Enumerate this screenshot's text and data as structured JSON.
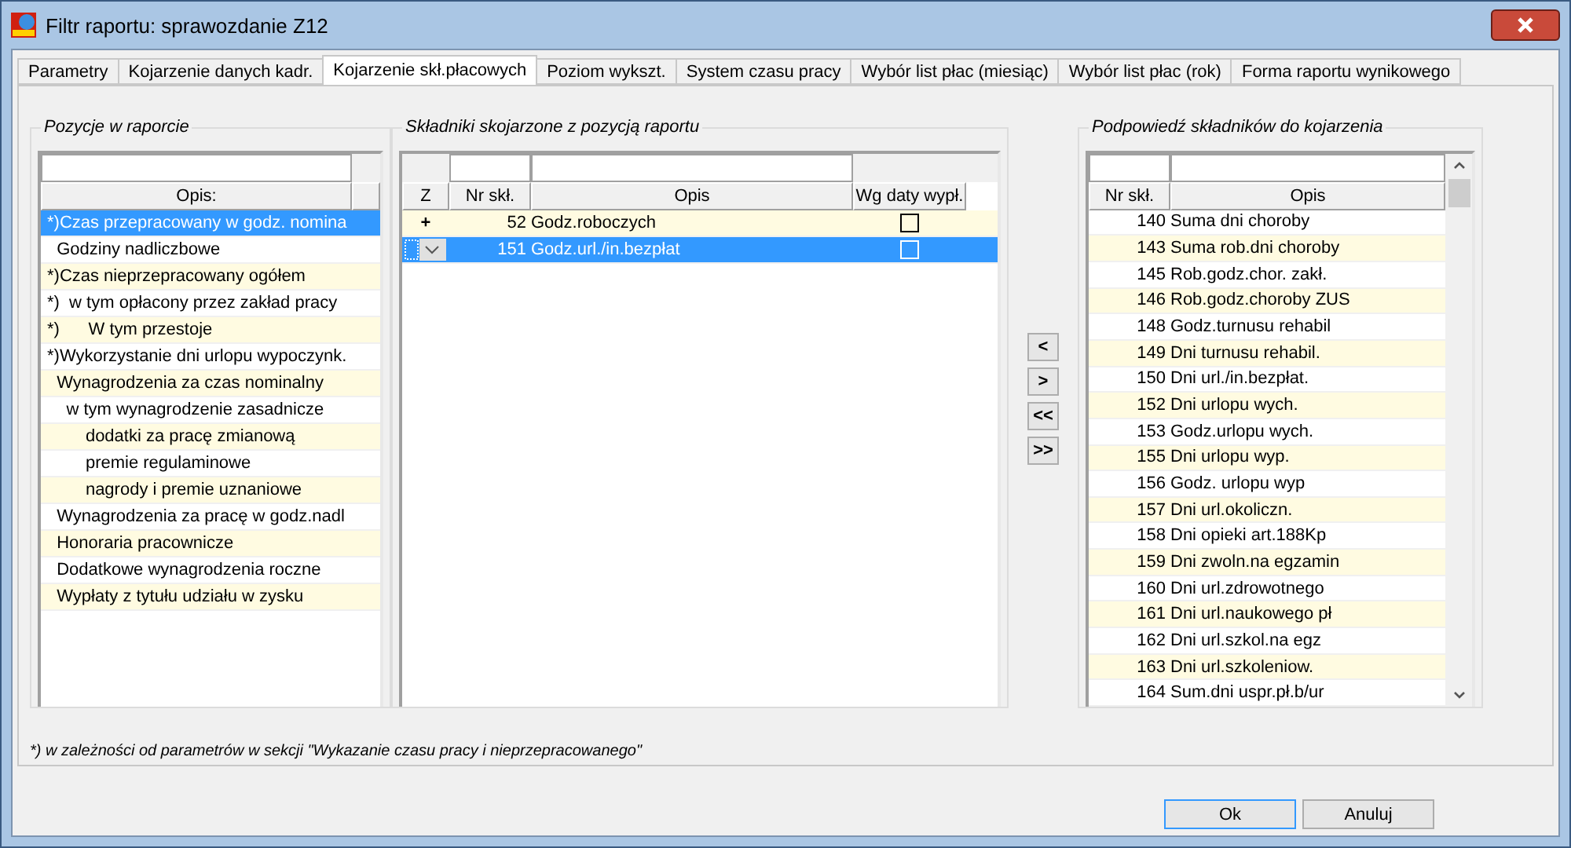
{
  "window": {
    "title": "Filtr raportu: sprawozdanie Z12"
  },
  "tabs": [
    {
      "label": "Parametry",
      "selected": false
    },
    {
      "label": "Kojarzenie danych kadr.",
      "selected": false
    },
    {
      "label": "Kojarzenie skł.płacowych",
      "selected": true
    },
    {
      "label": "Poziom wykszt.",
      "selected": false
    },
    {
      "label": "System czasu pracy",
      "selected": false
    },
    {
      "label": "Wybór list płac (miesiąc)",
      "selected": false
    },
    {
      "label": "Wybór list płac (rok)",
      "selected": false
    },
    {
      "label": "Forma raportu wynikowego",
      "selected": false
    }
  ],
  "positions": {
    "title": "Pozycje w raporcie",
    "column": "Opis:",
    "rows": [
      {
        "text": "*)Czas przepracowany w godz. nomina",
        "selected": true
      },
      {
        "text": "  Godziny nadliczbowe",
        "selected": false
      },
      {
        "text": "*)Czas nieprzepracowany ogółem",
        "selected": false
      },
      {
        "text": "*)  w tym opłacony przez zakład pracy",
        "selected": false
      },
      {
        "text": "*)      W tym przestoje",
        "selected": false
      },
      {
        "text": "*)Wykorzystanie dni urlopu wypoczynk.",
        "selected": false
      },
      {
        "text": "  Wynagrodzenia za czas nominalny",
        "selected": false
      },
      {
        "text": "    w tym wynagrodzenie zasadnicze",
        "selected": false
      },
      {
        "text": "        dodatki za pracę zmianową",
        "selected": false
      },
      {
        "text": "        premie regulaminowe",
        "selected": false
      },
      {
        "text": "        nagrody i premie uznaniowe",
        "selected": false
      },
      {
        "text": "  Wynagrodzenia za pracę w godz.nadl",
        "selected": false
      },
      {
        "text": "  Honoraria pracownicze",
        "selected": false
      },
      {
        "text": "  Dodatkowe wynagrodzenia roczne",
        "selected": false
      },
      {
        "text": "  Wypłaty z tytułu udziału w zysku",
        "selected": false
      }
    ]
  },
  "linked": {
    "title": "Składniki skojarzone z pozycją raportu",
    "columns": [
      "Z",
      "Nr skł.",
      "Opis",
      "Wg daty wypł."
    ],
    "rows": [
      {
        "z": "+",
        "nr": "52",
        "opis": "Godz.roboczych",
        "checked": false,
        "selected": false
      },
      {
        "nr": "151",
        "opis": "Godz.url./in.bezpłat",
        "checked": false,
        "selected": true
      }
    ]
  },
  "move_buttons": [
    "<",
    ">",
    "<<",
    ">>"
  ],
  "suggestions": {
    "title": "Podpowiedź składników do kojarzenia",
    "columns": [
      "Nr skł.",
      "Opis"
    ],
    "rows": [
      {
        "nr": "140",
        "opis": "Suma dni choroby"
      },
      {
        "nr": "143",
        "opis": "Suma rob.dni choroby"
      },
      {
        "nr": "145",
        "opis": "Rob.godz.chor. zakł."
      },
      {
        "nr": "146",
        "opis": "Rob.godz.choroby ZUS"
      },
      {
        "nr": "148",
        "opis": "Godz.turnusu rehabil"
      },
      {
        "nr": "149",
        "opis": "Dni turnusu rehabil."
      },
      {
        "nr": "150",
        "opis": "Dni url./in.bezpłat."
      },
      {
        "nr": "152",
        "opis": "Dni urlopu wych."
      },
      {
        "nr": "153",
        "opis": "Godz.urlopu wych."
      },
      {
        "nr": "155",
        "opis": "Dni urlopu wyp."
      },
      {
        "nr": "156",
        "opis": "Godz. urlopu wyp"
      },
      {
        "nr": "157",
        "opis": "Dni url.okoliczn."
      },
      {
        "nr": "158",
        "opis": "Dni opieki art.188Kp"
      },
      {
        "nr": "159",
        "opis": "Dni zwoln.na egzamin"
      },
      {
        "nr": "160",
        "opis": "Dni url.zdrowotnego"
      },
      {
        "nr": "161",
        "opis": "Dni url.naukowego pł"
      },
      {
        "nr": "162",
        "opis": "Dni url.szkol.na egz"
      },
      {
        "nr": "163",
        "opis": "Dni url.szkoleniow."
      },
      {
        "nr": "164",
        "opis": "Sum.dni uspr.pł.b/ur"
      }
    ]
  },
  "footnote": "*)  w zależności od parametrów w sekcji \"Wykazanie czasu pracy i nieprzepracowanego\"",
  "buttons": [
    "Ok",
    "Anuluj"
  ]
}
